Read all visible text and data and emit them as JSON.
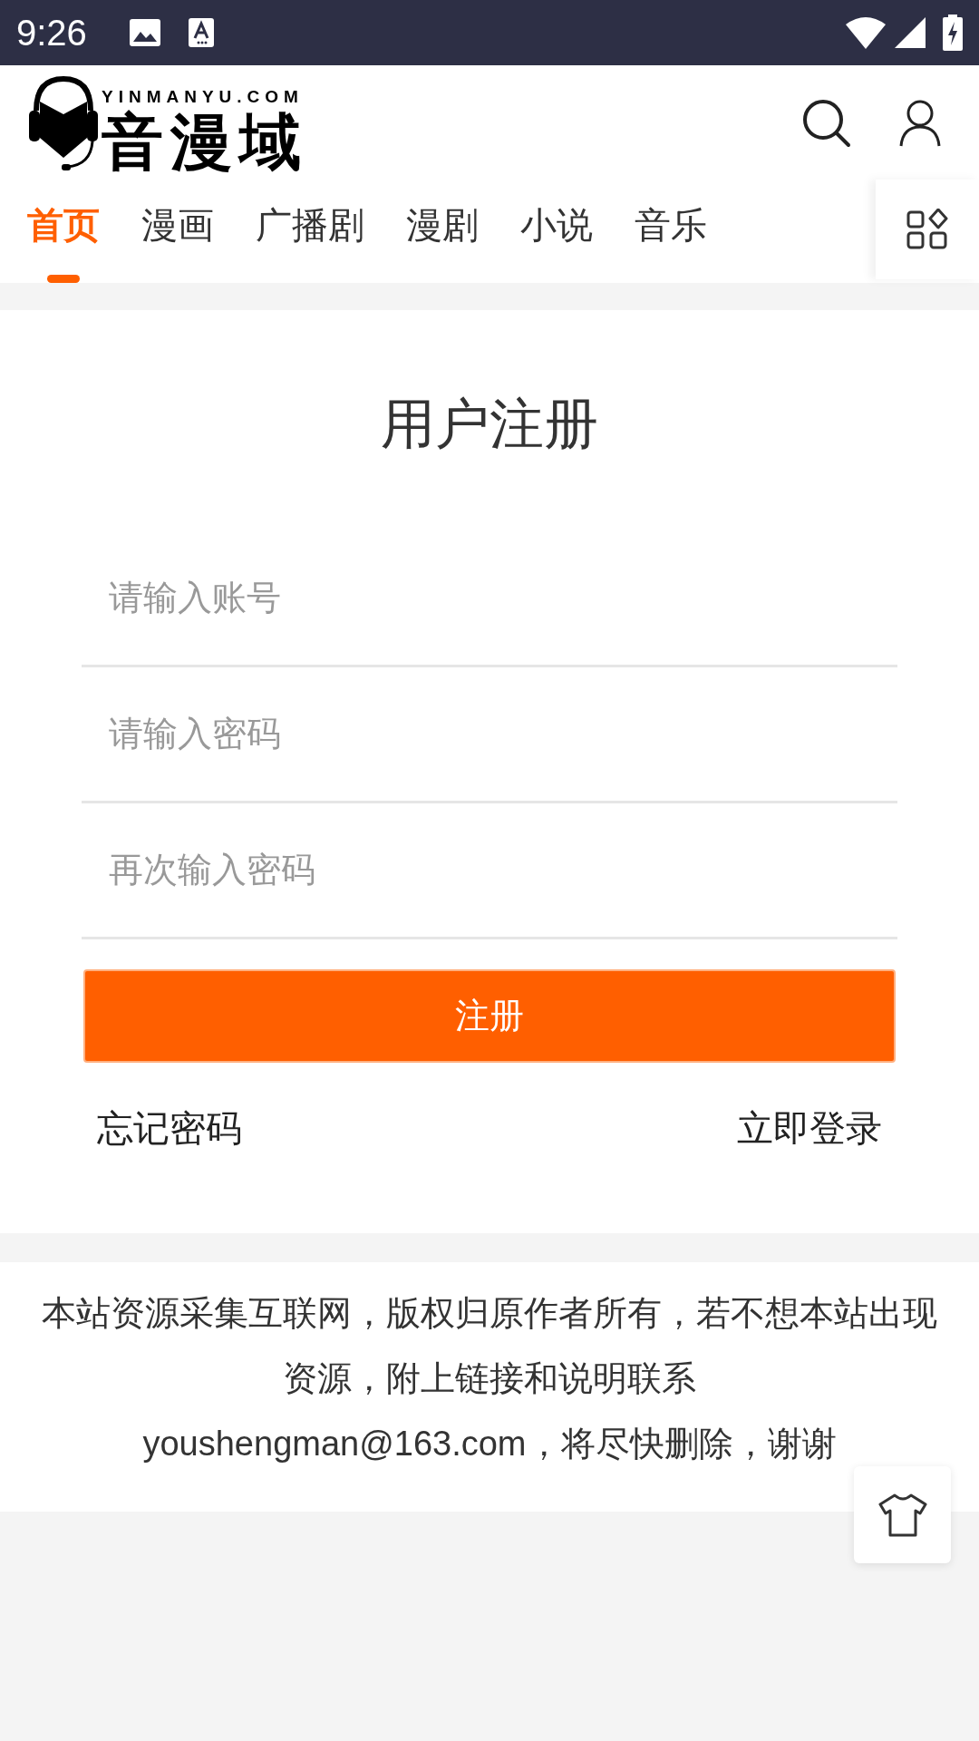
{
  "status_bar": {
    "time": "9:26"
  },
  "logo": {
    "domain": "YINMANYU.COM",
    "name": "音漫域"
  },
  "tabs": [
    {
      "label": "首页",
      "selected": true
    },
    {
      "label": "漫画",
      "selected": false
    },
    {
      "label": "广播剧",
      "selected": false
    },
    {
      "label": "漫剧",
      "selected": false
    },
    {
      "label": "小说",
      "selected": false
    },
    {
      "label": "音乐",
      "selected": false
    }
  ],
  "form": {
    "title": "用户注册",
    "fields": [
      {
        "placeholder": "请输入账号"
      },
      {
        "placeholder": "请输入密码"
      },
      {
        "placeholder": "再次输入密码"
      }
    ],
    "submit": "注册",
    "forgot": "忘记密码",
    "login": "立即登录"
  },
  "footer": {
    "lines": [
      "本站资源采集互联网，版权归原作者所有，若不想本站出现资源，附上链接和说明联系",
      "youshengman@163.com，将尽快删除，谢谢"
    ]
  }
}
